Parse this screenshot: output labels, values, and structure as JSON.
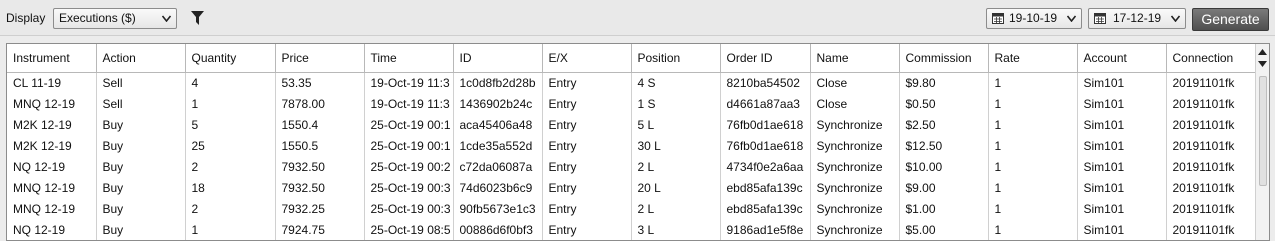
{
  "toolbar": {
    "display_label": "Display",
    "display_value": "Executions ($)",
    "date_from": "19-10-19",
    "date_to": "17-12-19",
    "generate_label": "Generate"
  },
  "table": {
    "columns": [
      "Instrument",
      "Action",
      "Quantity",
      "Price",
      "Time",
      "ID",
      "E/X",
      "Position",
      "Order ID",
      "Name",
      "Commission",
      "Rate",
      "Account",
      "Connection"
    ],
    "rows": [
      [
        "CL 11-19",
        "Sell",
        "4",
        "53.35",
        "19-Oct-19 11:3",
        "1c0d8fb2d28b",
        "Entry",
        "4 S",
        "8210ba54502",
        "Close",
        "$9.80",
        "1",
        "Sim101",
        "20191101fk"
      ],
      [
        "MNQ 12-19",
        "Sell",
        "1",
        "7878.00",
        "19-Oct-19 11:3",
        "1436902b24c",
        "Entry",
        "1 S",
        "d4661a87aa3",
        "Close",
        "$0.50",
        "1",
        "Sim101",
        "20191101fk"
      ],
      [
        "M2K 12-19",
        "Buy",
        "5",
        "1550.4",
        "25-Oct-19 00:1",
        "aca45406a48",
        "Entry",
        "5 L",
        "76fb0d1ae618",
        "Synchronize",
        "$2.50",
        "1",
        "Sim101",
        "20191101fk"
      ],
      [
        "M2K 12-19",
        "Buy",
        "25",
        "1550.5",
        "25-Oct-19 00:1",
        "1cde35a552d",
        "Entry",
        "30 L",
        "76fb0d1ae618",
        "Synchronize",
        "$12.50",
        "1",
        "Sim101",
        "20191101fk"
      ],
      [
        "NQ 12-19",
        "Buy",
        "2",
        "7932.50",
        "25-Oct-19 00:2",
        "c72da06087a",
        "Entry",
        "2 L",
        "4734f0e2a6aa",
        "Synchronize",
        "$10.00",
        "1",
        "Sim101",
        "20191101fk"
      ],
      [
        "MNQ 12-19",
        "Buy",
        "18",
        "7932.50",
        "25-Oct-19 00:3",
        "74d6023b6c9",
        "Entry",
        "20 L",
        "ebd85afa139c",
        "Synchronize",
        "$9.00",
        "1",
        "Sim101",
        "20191101fk"
      ],
      [
        "MNQ 12-19",
        "Buy",
        "2",
        "7932.25",
        "25-Oct-19 00:3",
        "90fb5673e1c3",
        "Entry",
        "2 L",
        "ebd85afa139c",
        "Synchronize",
        "$1.00",
        "1",
        "Sim101",
        "20191101fk"
      ],
      [
        "NQ 12-19",
        "Buy",
        "1",
        "7924.75",
        "25-Oct-19 08:5",
        "00886d6f0bf3",
        "Entry",
        "3 L",
        "9186ad1e5f8e",
        "Synchronize",
        "$5.00",
        "1",
        "Sim101",
        "20191101fk"
      ]
    ]
  },
  "icons": {
    "filter": "filter-icon",
    "calendar": "calendar-icon",
    "dropdown": "chevron-down-icon"
  }
}
